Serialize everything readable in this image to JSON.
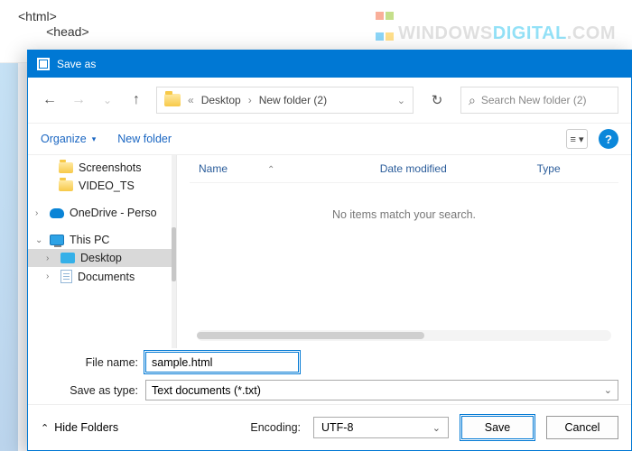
{
  "watermark": {
    "part1": "W",
    "part2": "INDOWS",
    "part3": "D",
    "part4": "IGITAL",
    "part5": ".COM"
  },
  "editor": {
    "line1": "<html>",
    "line2": "        <head>"
  },
  "dialog": {
    "title": "Save as",
    "breadcrumb": {
      "sep": "«",
      "seg1": "Desktop",
      "seg2": "New folder (2)"
    },
    "search_placeholder": "Search New folder (2)",
    "organize": "Organize",
    "newfolder": "New folder",
    "help": "?",
    "columns": {
      "name": "Name",
      "date": "Date modified",
      "type": "Type"
    },
    "empty_msg": "No items match your search.",
    "sidebar": {
      "screenshots": "Screenshots",
      "video_ts": "VIDEO_TS",
      "onedrive": "OneDrive - Perso",
      "thispc": "This PC",
      "desktop": "Desktop",
      "documents": "Documents"
    },
    "filename_label": "File name:",
    "filename_value": "sample.html",
    "saveastype_label": "Save as type:",
    "saveastype_value": "Text documents (*.txt)",
    "hidefolders": "Hide Folders",
    "encoding_label": "Encoding:",
    "encoding_value": "UTF-8",
    "save": "Save",
    "cancel": "Cancel"
  }
}
